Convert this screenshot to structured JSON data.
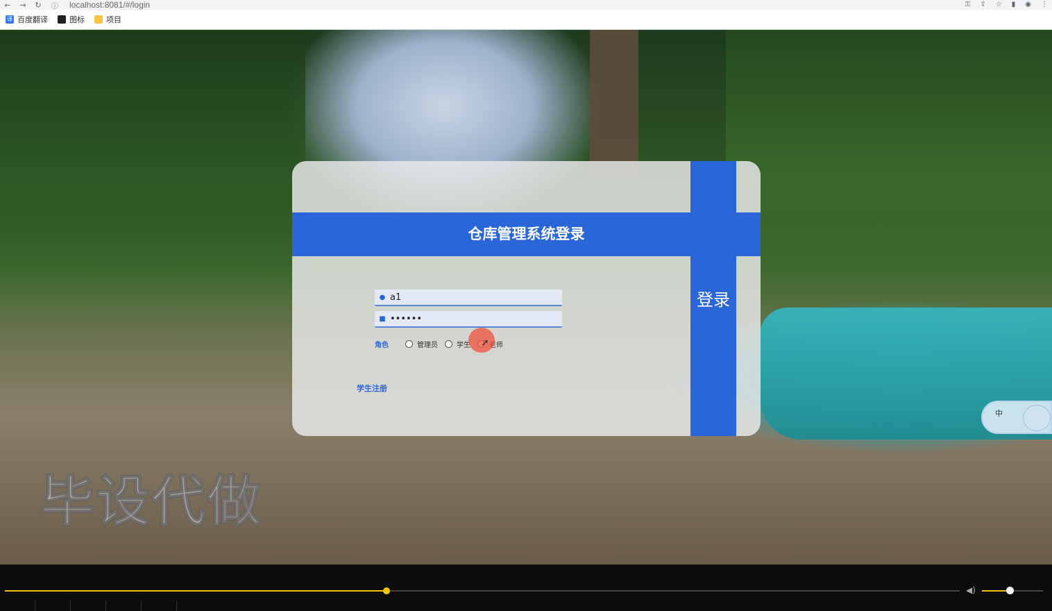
{
  "browser": {
    "url": "localhost:8081/#/login",
    "nav": {
      "back": "←",
      "forward": "→",
      "reload": "↻"
    },
    "info_icon": "ⓘ",
    "toolbar_icons": [
      "⚿",
      "⇪",
      "☆",
      "▮",
      "◉",
      "⋮"
    ],
    "bookmarks": [
      {
        "label": "百度翻译",
        "icon": "translate-icon",
        "color": "#3478f6"
      },
      {
        "label": "图标",
        "icon": "image-icon",
        "color": "#222222"
      },
      {
        "label": "项目",
        "icon": "folder-icon",
        "color": "#f5c542"
      }
    ]
  },
  "login": {
    "title": "仓库管理系统登录",
    "login_button": "登录",
    "username_value": "a1",
    "password_value": "••••••",
    "user_icon": "👤",
    "lock_icon": "🔒",
    "role_label": "角色",
    "roles": [
      "管理员",
      "学生",
      "老师"
    ],
    "register_link": "学生注册",
    "accent_color": "#2a66d8"
  },
  "watermark": "毕设代做",
  "ime": {
    "label": "中"
  },
  "player": {
    "progress": 0.4,
    "volume": 0.45,
    "accent_color": "#f0c30a",
    "volume_icon": "🔈"
  }
}
